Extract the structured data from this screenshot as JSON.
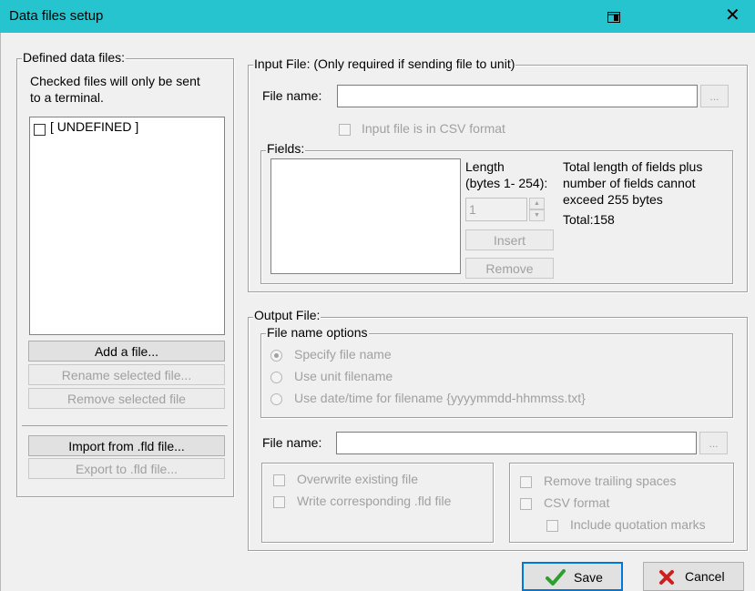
{
  "window": {
    "title": "Data files setup"
  },
  "defined": {
    "legend": "Defined data files:",
    "note_line1": "Checked files will only be sent",
    "note_line2": "to a terminal.",
    "items": [
      {
        "label": "[ UNDEFINED ]",
        "checked": false
      }
    ],
    "add_label": "Add a file...",
    "rename_label": "Rename selected  file...",
    "remove_label": "Remove selected file",
    "import_label": "Import from .fld file...",
    "export_label": "Export to .fld file..."
  },
  "input_file": {
    "legend": "Input File: (Only required if sending file to unit)",
    "file_name_label": "File name:",
    "file_name_value": "",
    "browse_label": "...",
    "csv_label": "Input file is in CSV format",
    "fields": {
      "legend": "Fields:",
      "length_line1": "Length",
      "length_line2": "(bytes 1- 254):",
      "length_value": "1",
      "insert_label": "Insert",
      "remove_label": "Remove",
      "info_line1": "Total length of fields plus",
      "info_line2": "number of fields cannot",
      "info_line3": "exceed 255 bytes",
      "total_label": "Total:158"
    }
  },
  "output_file": {
    "legend": "Output File:",
    "options_legend": "File name options",
    "opt_specify": "Specify file name",
    "opt_unit": "Use unit filename",
    "opt_datetime": "Use date/time for filename {yyyymmdd-hhmmss.txt}",
    "file_name_label": "File name:",
    "file_name_value": "",
    "browse_label": "...",
    "overwrite_label": "Overwrite existing file",
    "write_fld_label": "Write corresponding .fld file",
    "trailing_label": "Remove trailing spaces",
    "csv_label": "CSV format",
    "quotes_label": "Include quotation marks"
  },
  "footer": {
    "save_label": "Save",
    "cancel_label": "Cancel"
  },
  "colors": {
    "titlebar": "#26c4ce",
    "save_check": "#2e9e2e",
    "cancel_x": "#cc1f1f"
  }
}
